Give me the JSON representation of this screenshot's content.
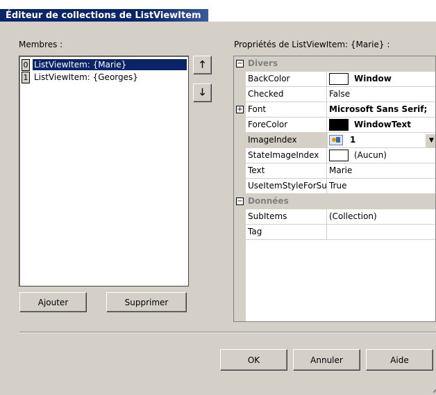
{
  "window": {
    "title": "Éditeur de collections de ListViewItem"
  },
  "members": {
    "label": "Membres :",
    "items": [
      {
        "index": "0",
        "text": "ListViewItem: {Marie}",
        "selected": true
      },
      {
        "index": "1",
        "text": "ListViewItem: {Georges}",
        "selected": false
      }
    ],
    "move_up_icon": "up-arrow-icon",
    "move_down_icon": "down-arrow-icon",
    "add_label": "Ajouter",
    "remove_label": "Supprimer"
  },
  "properties": {
    "label": "Propriétés de ListViewItem: {Marie} :",
    "rows": [
      {
        "type": "category",
        "name": "Divers",
        "expander": "⊟"
      },
      {
        "type": "prop",
        "name": "BackColor",
        "value": "Window",
        "swatch": "#ffffff",
        "bold": true
      },
      {
        "type": "prop",
        "name": "Checked",
        "value": "False"
      },
      {
        "type": "prop",
        "name": "Font",
        "value": "Microsoft Sans Serif;",
        "bold": true,
        "expander": "⊞"
      },
      {
        "type": "prop",
        "name": "ForeColor",
        "value": "WindowText",
        "swatch": "#000000",
        "bold": true
      },
      {
        "type": "prop",
        "name": "ImageIndex",
        "value": "1",
        "icon": "image-list-icon",
        "bold": true,
        "selected": true,
        "dropdown": true
      },
      {
        "type": "prop",
        "name": "StateImageIndex",
        "value": "(Aucun)",
        "swatch": "#ffffff"
      },
      {
        "type": "prop",
        "name": "Text",
        "value": "Marie"
      },
      {
        "type": "prop",
        "name": "UseItemStyleForSubItems",
        "value": "True"
      },
      {
        "type": "category",
        "name": "Données",
        "expander": "⊟"
      },
      {
        "type": "prop",
        "name": "SubItems",
        "value": "(Collection)"
      },
      {
        "type": "prop",
        "name": "Tag",
        "value": ""
      }
    ]
  },
  "buttons": {
    "ok": "OK",
    "cancel": "Annuler",
    "help": "Aide"
  }
}
